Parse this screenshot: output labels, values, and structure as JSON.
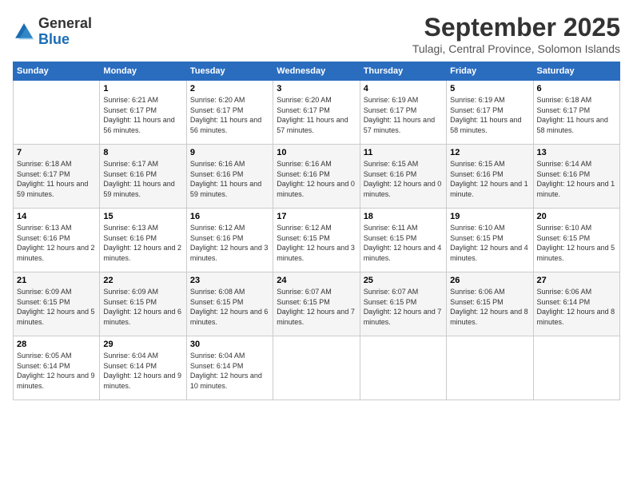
{
  "logo": {
    "text_general": "General",
    "text_blue": "Blue"
  },
  "header": {
    "month_title": "September 2025",
    "subtitle": "Tulagi, Central Province, Solomon Islands"
  },
  "weekdays": [
    "Sunday",
    "Monday",
    "Tuesday",
    "Wednesday",
    "Thursday",
    "Friday",
    "Saturday"
  ],
  "weeks": [
    [
      {
        "day": "",
        "sunrise": "",
        "sunset": "",
        "daylight": ""
      },
      {
        "day": "1",
        "sunrise": "Sunrise: 6:21 AM",
        "sunset": "Sunset: 6:17 PM",
        "daylight": "Daylight: 11 hours and 56 minutes."
      },
      {
        "day": "2",
        "sunrise": "Sunrise: 6:20 AM",
        "sunset": "Sunset: 6:17 PM",
        "daylight": "Daylight: 11 hours and 56 minutes."
      },
      {
        "day": "3",
        "sunrise": "Sunrise: 6:20 AM",
        "sunset": "Sunset: 6:17 PM",
        "daylight": "Daylight: 11 hours and 57 minutes."
      },
      {
        "day": "4",
        "sunrise": "Sunrise: 6:19 AM",
        "sunset": "Sunset: 6:17 PM",
        "daylight": "Daylight: 11 hours and 57 minutes."
      },
      {
        "day": "5",
        "sunrise": "Sunrise: 6:19 AM",
        "sunset": "Sunset: 6:17 PM",
        "daylight": "Daylight: 11 hours and 58 minutes."
      },
      {
        "day": "6",
        "sunrise": "Sunrise: 6:18 AM",
        "sunset": "Sunset: 6:17 PM",
        "daylight": "Daylight: 11 hours and 58 minutes."
      }
    ],
    [
      {
        "day": "7",
        "sunrise": "Sunrise: 6:18 AM",
        "sunset": "Sunset: 6:17 PM",
        "daylight": "Daylight: 11 hours and 59 minutes."
      },
      {
        "day": "8",
        "sunrise": "Sunrise: 6:17 AM",
        "sunset": "Sunset: 6:16 PM",
        "daylight": "Daylight: 11 hours and 59 minutes."
      },
      {
        "day": "9",
        "sunrise": "Sunrise: 6:16 AM",
        "sunset": "Sunset: 6:16 PM",
        "daylight": "Daylight: 11 hours and 59 minutes."
      },
      {
        "day": "10",
        "sunrise": "Sunrise: 6:16 AM",
        "sunset": "Sunset: 6:16 PM",
        "daylight": "Daylight: 12 hours and 0 minutes."
      },
      {
        "day": "11",
        "sunrise": "Sunrise: 6:15 AM",
        "sunset": "Sunset: 6:16 PM",
        "daylight": "Daylight: 12 hours and 0 minutes."
      },
      {
        "day": "12",
        "sunrise": "Sunrise: 6:15 AM",
        "sunset": "Sunset: 6:16 PM",
        "daylight": "Daylight: 12 hours and 1 minute."
      },
      {
        "day": "13",
        "sunrise": "Sunrise: 6:14 AM",
        "sunset": "Sunset: 6:16 PM",
        "daylight": "Daylight: 12 hours and 1 minute."
      }
    ],
    [
      {
        "day": "14",
        "sunrise": "Sunrise: 6:13 AM",
        "sunset": "Sunset: 6:16 PM",
        "daylight": "Daylight: 12 hours and 2 minutes."
      },
      {
        "day": "15",
        "sunrise": "Sunrise: 6:13 AM",
        "sunset": "Sunset: 6:16 PM",
        "daylight": "Daylight: 12 hours and 2 minutes."
      },
      {
        "day": "16",
        "sunrise": "Sunrise: 6:12 AM",
        "sunset": "Sunset: 6:16 PM",
        "daylight": "Daylight: 12 hours and 3 minutes."
      },
      {
        "day": "17",
        "sunrise": "Sunrise: 6:12 AM",
        "sunset": "Sunset: 6:15 PM",
        "daylight": "Daylight: 12 hours and 3 minutes."
      },
      {
        "day": "18",
        "sunrise": "Sunrise: 6:11 AM",
        "sunset": "Sunset: 6:15 PM",
        "daylight": "Daylight: 12 hours and 4 minutes."
      },
      {
        "day": "19",
        "sunrise": "Sunrise: 6:10 AM",
        "sunset": "Sunset: 6:15 PM",
        "daylight": "Daylight: 12 hours and 4 minutes."
      },
      {
        "day": "20",
        "sunrise": "Sunrise: 6:10 AM",
        "sunset": "Sunset: 6:15 PM",
        "daylight": "Daylight: 12 hours and 5 minutes."
      }
    ],
    [
      {
        "day": "21",
        "sunrise": "Sunrise: 6:09 AM",
        "sunset": "Sunset: 6:15 PM",
        "daylight": "Daylight: 12 hours and 5 minutes."
      },
      {
        "day": "22",
        "sunrise": "Sunrise: 6:09 AM",
        "sunset": "Sunset: 6:15 PM",
        "daylight": "Daylight: 12 hours and 6 minutes."
      },
      {
        "day": "23",
        "sunrise": "Sunrise: 6:08 AM",
        "sunset": "Sunset: 6:15 PM",
        "daylight": "Daylight: 12 hours and 6 minutes."
      },
      {
        "day": "24",
        "sunrise": "Sunrise: 6:07 AM",
        "sunset": "Sunset: 6:15 PM",
        "daylight": "Daylight: 12 hours and 7 minutes."
      },
      {
        "day": "25",
        "sunrise": "Sunrise: 6:07 AM",
        "sunset": "Sunset: 6:15 PM",
        "daylight": "Daylight: 12 hours and 7 minutes."
      },
      {
        "day": "26",
        "sunrise": "Sunrise: 6:06 AM",
        "sunset": "Sunset: 6:15 PM",
        "daylight": "Daylight: 12 hours and 8 minutes."
      },
      {
        "day": "27",
        "sunrise": "Sunrise: 6:06 AM",
        "sunset": "Sunset: 6:14 PM",
        "daylight": "Daylight: 12 hours and 8 minutes."
      }
    ],
    [
      {
        "day": "28",
        "sunrise": "Sunrise: 6:05 AM",
        "sunset": "Sunset: 6:14 PM",
        "daylight": "Daylight: 12 hours and 9 minutes."
      },
      {
        "day": "29",
        "sunrise": "Sunrise: 6:04 AM",
        "sunset": "Sunset: 6:14 PM",
        "daylight": "Daylight: 12 hours and 9 minutes."
      },
      {
        "day": "30",
        "sunrise": "Sunrise: 6:04 AM",
        "sunset": "Sunset: 6:14 PM",
        "daylight": "Daylight: 12 hours and 10 minutes."
      },
      {
        "day": "",
        "sunrise": "",
        "sunset": "",
        "daylight": ""
      },
      {
        "day": "",
        "sunrise": "",
        "sunset": "",
        "daylight": ""
      },
      {
        "day": "",
        "sunrise": "",
        "sunset": "",
        "daylight": ""
      },
      {
        "day": "",
        "sunrise": "",
        "sunset": "",
        "daylight": ""
      }
    ]
  ]
}
